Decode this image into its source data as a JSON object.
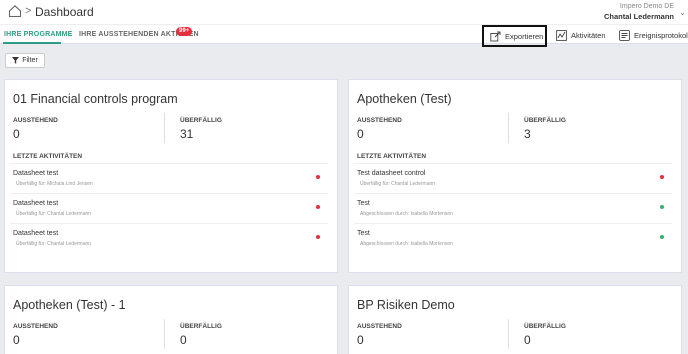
{
  "header": {
    "title": "Dashboard",
    "org": "Impero Demo DE",
    "user": "Chantal Ledermann"
  },
  "tabs": {
    "programs": "IHRE PROGRAMME",
    "pending": "IHRE AUSSTEHENDEN AKTIONEN",
    "pending_badge": "99+"
  },
  "toolbar": {
    "export": "Exportieren",
    "activities": "Aktivitäten",
    "event_log": "Ereignisprotokoll"
  },
  "filter": {
    "label": "Filter"
  },
  "labels": {
    "pending": "AUSSTEHEND",
    "overdue": "ÜBERFÄLLIG",
    "recent": "LETZTE AKTIVITÄTEN"
  },
  "colors": {
    "red": "#e0323a",
    "green": "#2fb56a",
    "accent": "#2f9c87"
  },
  "cards": [
    {
      "title": "01 Financial controls program",
      "pending": "0",
      "overdue": "31",
      "activities": [
        {
          "title": "Datasheet test",
          "sub": "Überfällig für: Michala Lind Jensen",
          "status": "red"
        },
        {
          "title": "Datasheet test",
          "sub": "Überfällig für: Chantal Ledermann",
          "status": "red"
        },
        {
          "title": "Datasheet test",
          "sub": "Überfällig für: Chantal Ledermann",
          "status": "red"
        }
      ]
    },
    {
      "title": "Apotheken (Test)",
      "pending": "0",
      "overdue": "3",
      "activities": [
        {
          "title": "Test datasheet control",
          "sub": "Überfällig für: Chantal Ledermann",
          "status": "red"
        },
        {
          "title": "Test",
          "sub": "Abgeschlossen durch: Isabella Mortensen",
          "status": "green"
        },
        {
          "title": "Test",
          "sub": "Abgeschlossen durch: Isabella Mortensen",
          "status": "green"
        }
      ]
    },
    {
      "title": "Apotheken (Test) - 1",
      "pending": "0",
      "overdue": "0"
    },
    {
      "title": "BP Risiken Demo",
      "pending": "0",
      "overdue": "0"
    }
  ]
}
